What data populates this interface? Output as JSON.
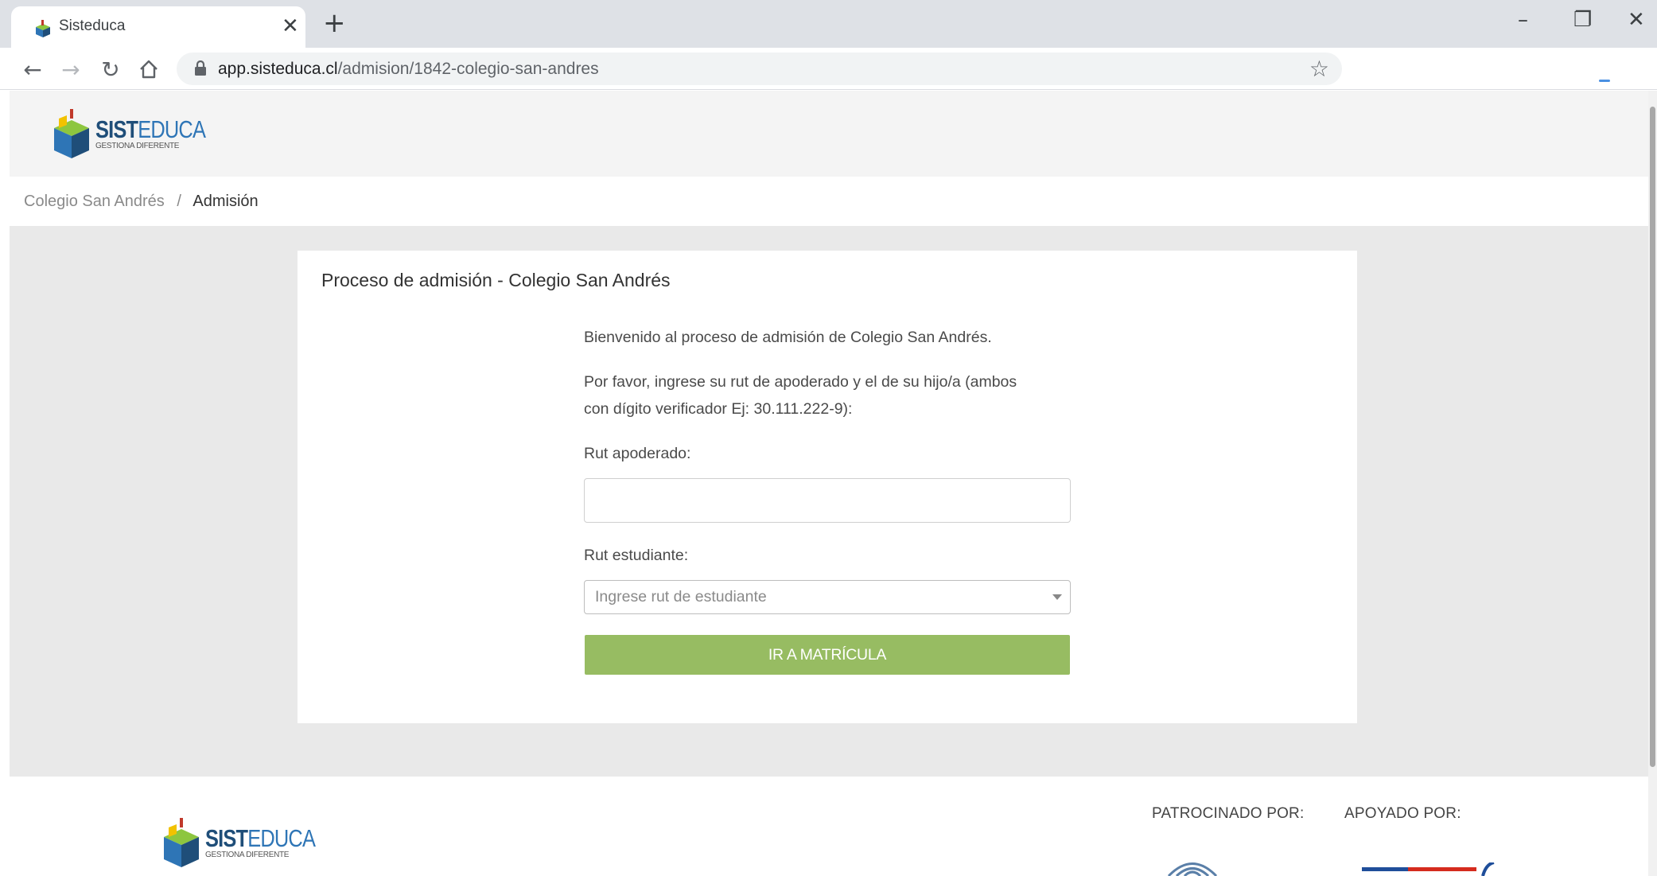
{
  "browser": {
    "tab_title": "Sisteduca",
    "tab_close": "✕",
    "new_tab": "+",
    "url_domain": "app.sisteduca.cl",
    "url_path": "/admision/1842-colegio-san-andres",
    "window_minimize": "–",
    "window_restore": "❐",
    "window_close": "✕"
  },
  "header": {
    "logo_word_a": "SIST",
    "logo_word_b": "EDUCA",
    "logo_tagline": "GESTIONA DIFERENTE"
  },
  "breadcrumb": {
    "parent": "Colegio San Andrés",
    "separator": "/",
    "current": "Admisión"
  },
  "card": {
    "title": "Proceso de admisión - Colegio San Andrés",
    "welcome": "Bienvenido al proceso de admisión de Colegio San Andrés.",
    "instructions_line1": "Por favor, ingrese su rut de apoderado y el de su hijo/a (ambos",
    "instructions_line2": "con dígito verificador Ej: 30.111.222-9):",
    "rut_apoderado_label": "Rut apoderado:",
    "rut_apoderado_value": "",
    "rut_estudiante_label": "Rut estudiante:",
    "rut_estudiante_placeholder": "Ingrese rut de estudiante",
    "submit_label": "IR A MATRÍCULA"
  },
  "footer": {
    "sponsored_by": "PATROCINADO POR:",
    "supported_by": "APOYADO POR:"
  },
  "colors": {
    "primary_button": "#97bc62",
    "logo_dark": "#1f4e79",
    "logo_light": "#2e75b6",
    "main_background": "#e9e9e9"
  }
}
